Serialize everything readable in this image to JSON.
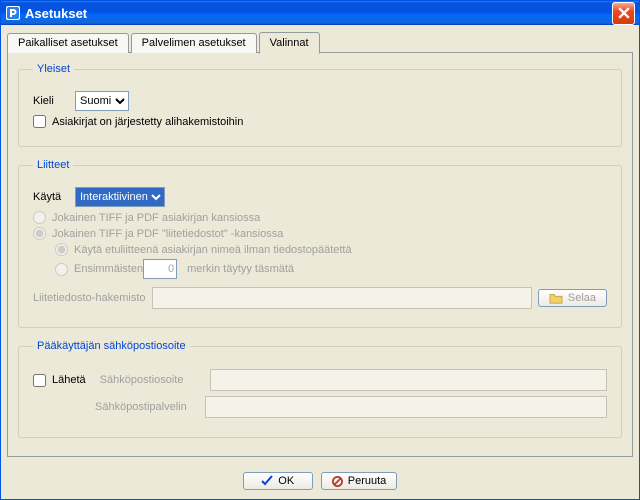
{
  "window": {
    "title": "Asetukset"
  },
  "tabs": [
    {
      "label": "Paikalliset asetukset",
      "selected": false
    },
    {
      "label": "Palvelimen asetukset",
      "selected": false
    },
    {
      "label": "Valinnat",
      "selected": true
    }
  ],
  "general": {
    "legend": "Yleiset",
    "language_label": "Kieli",
    "language_value": "Suomi",
    "subfolders_label": "Asiakirjat on järjestetty alihakemistoihin",
    "subfolders_checked": false
  },
  "attachments": {
    "legend": "Liitteet",
    "use_label": "Käytä",
    "use_value": "Interaktiivinen",
    "radio1": "Jokainen TIFF ja PDF asiakirjan kansiossa",
    "radio2": "Jokainen TIFF ja PDF \"liitetiedostot\" -kansiossa",
    "sub1": "Käytä etuliitteenä asiakirjan nimeä ilman tiedostopäätettä",
    "sub2a": "Ensimmäisten",
    "first_n": "0",
    "sub2b": "merkin täytyy täsmätä",
    "folder_label": "Liitetiedosto-hakemisto",
    "browse": "Selaa"
  },
  "email": {
    "legend": "Pääkäyttäjän sähköpostiosoite",
    "send_label": "Lähetä",
    "send_checked": false,
    "addr_label": "Sähköpostiosoite",
    "server_label": "Sähköpostipalvelin"
  },
  "buttons": {
    "ok": "OK",
    "cancel": "Peruuta"
  }
}
